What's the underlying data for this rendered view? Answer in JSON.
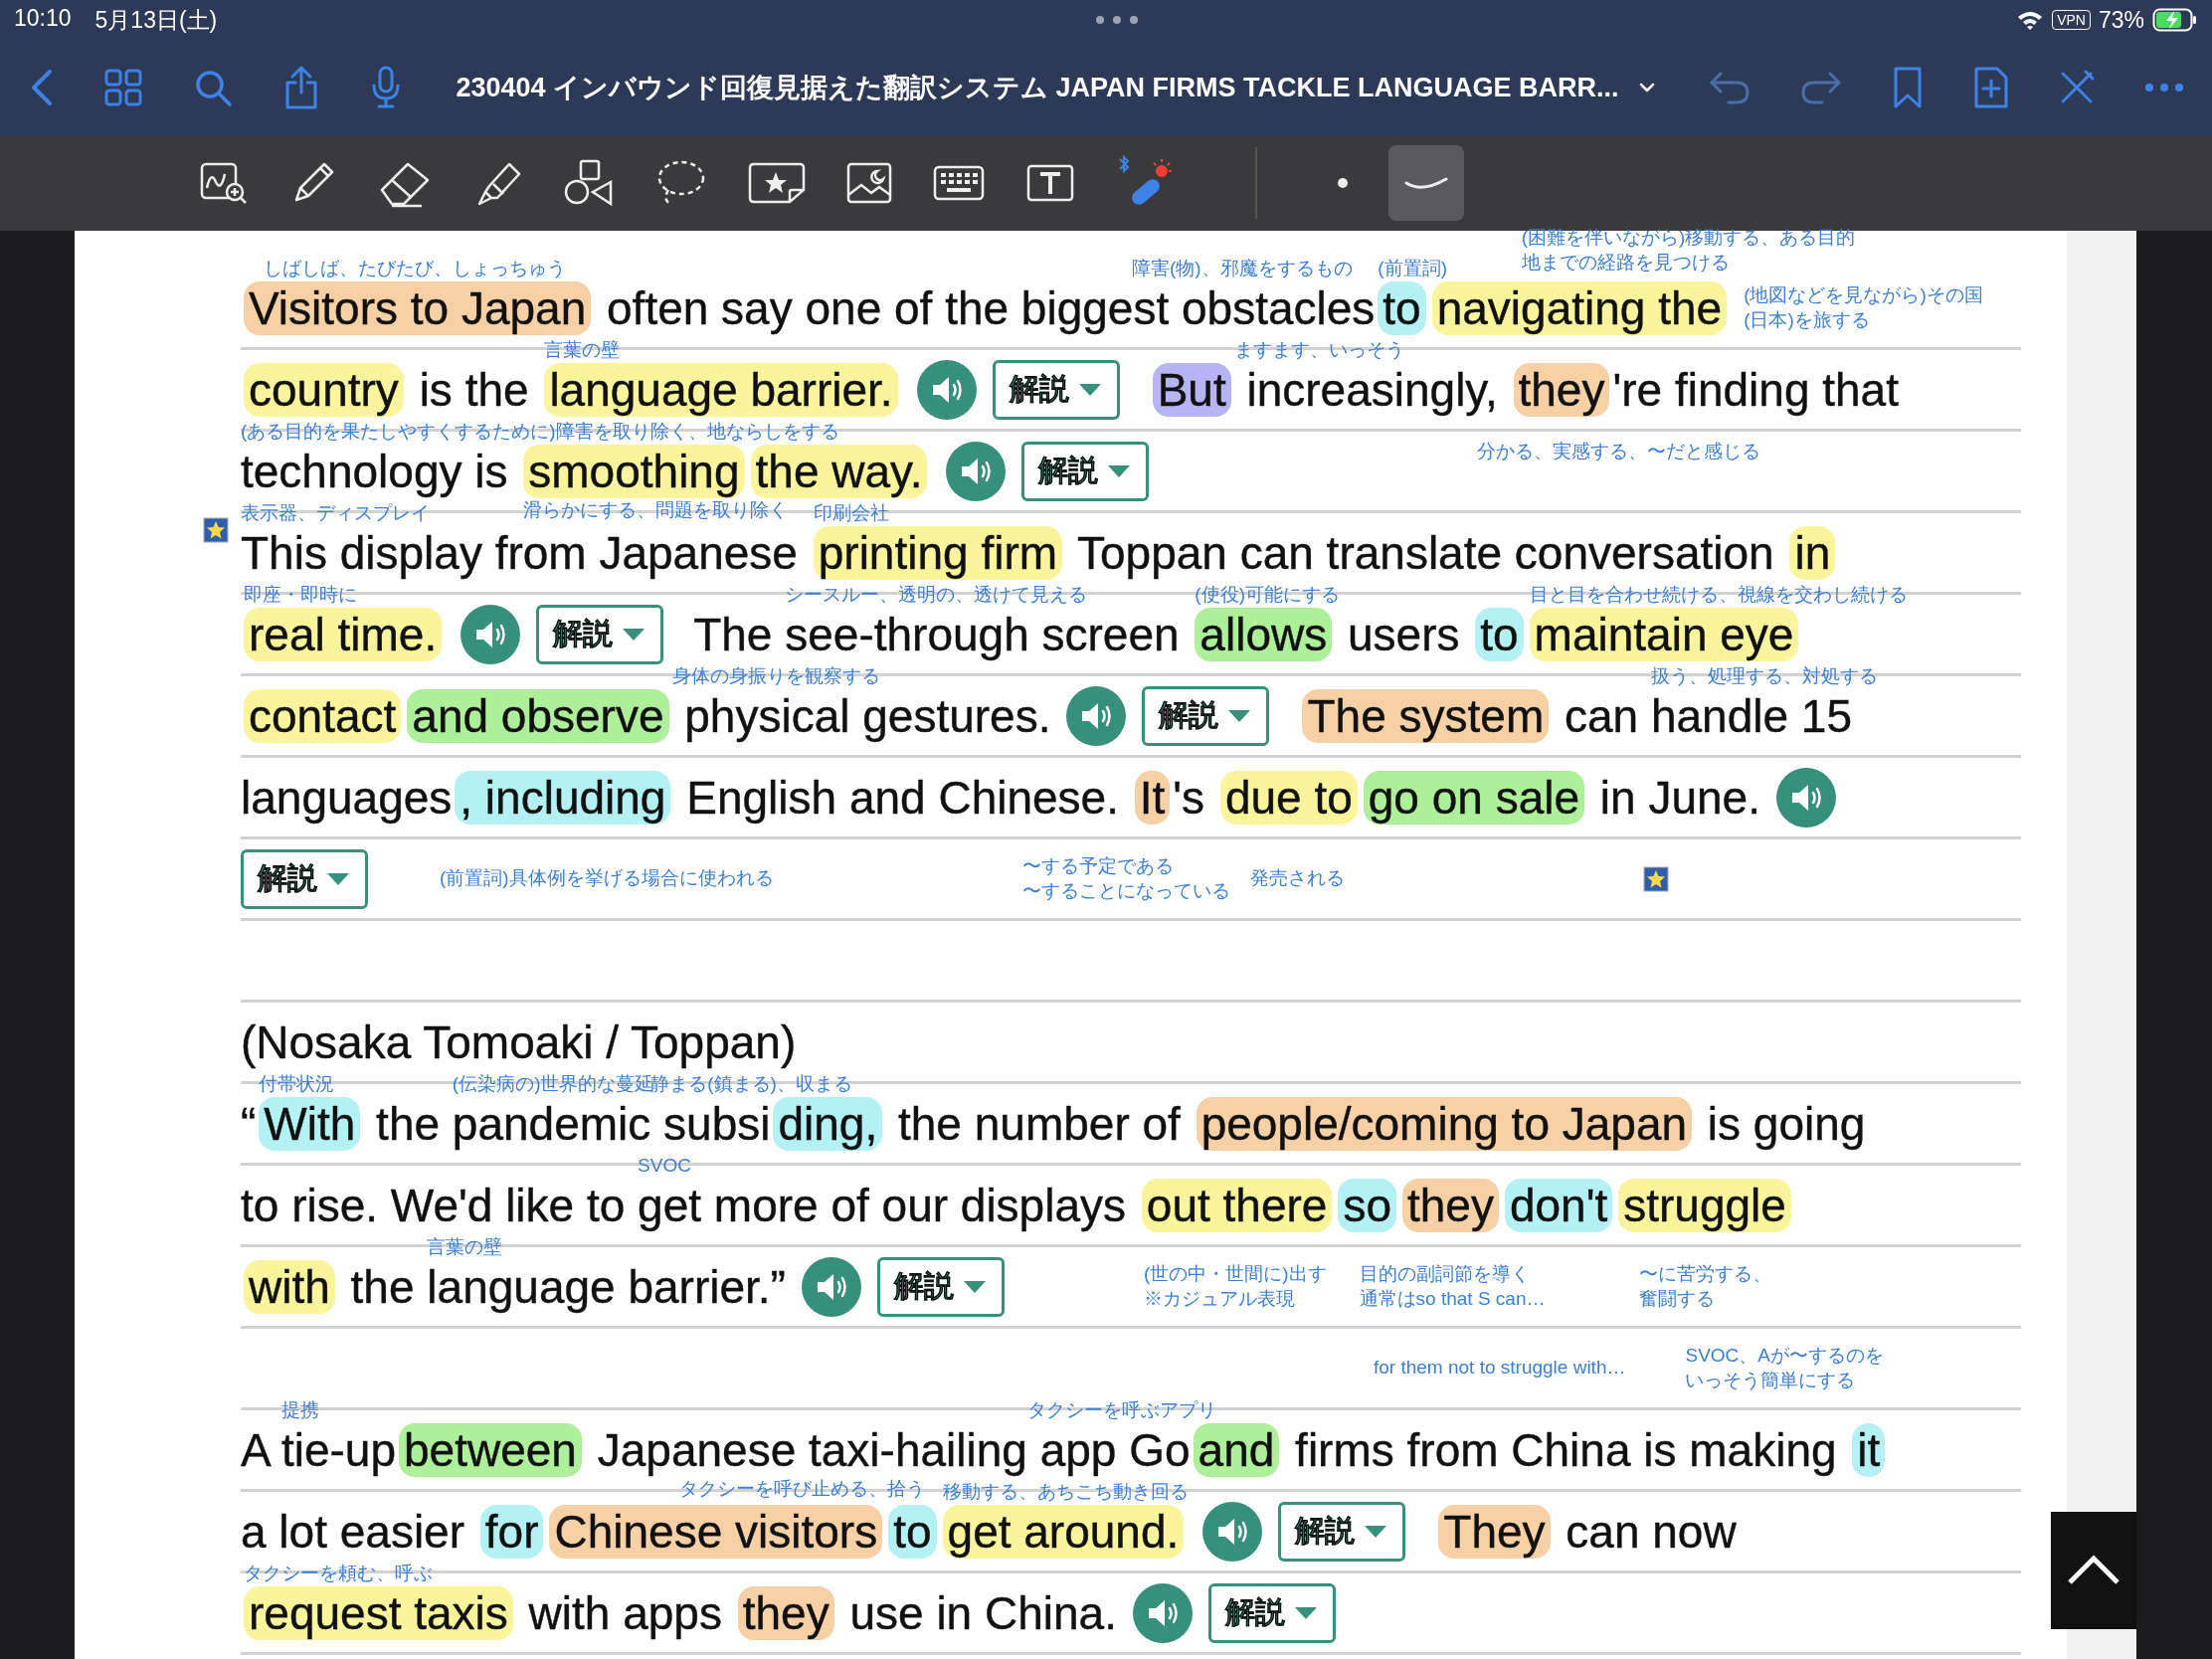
{
  "status_bar": {
    "time": "10:10",
    "date": "5月13日(土)",
    "vpn": "VPN",
    "battery": "73%"
  },
  "nav": {
    "title": "230404 インバウンド回復見据えた翻訳システム JAPAN FIRMS TACKLE LANGUAGE BARR..."
  },
  "toolbar": {
    "tools": [
      {
        "kind": "image-search",
        "selected": false
      },
      {
        "kind": "pencil",
        "selected": false
      },
      {
        "kind": "eraser",
        "selected": false
      },
      {
        "kind": "highlighter",
        "selected": false
      },
      {
        "kind": "shapes",
        "selected": false
      },
      {
        "kind": "lasso",
        "selected": false
      },
      {
        "kind": "sticker",
        "selected": false
      },
      {
        "kind": "image",
        "selected": false
      },
      {
        "kind": "keyboard",
        "selected": false
      },
      {
        "kind": "textbox",
        "selected": false
      },
      {
        "kind": "laser",
        "selected": false
      },
      {
        "kind": "dot",
        "selected": false
      },
      {
        "kind": "stroke",
        "selected": true
      }
    ]
  },
  "rows": [
    {
      "items": [
        {
          "kind": "text",
          "text": "Visitors to Japan",
          "color": "#f7d0a6",
          "note": "しばしば、たびたび、しょっちゅう"
        },
        {
          "kind": "text",
          "text": " often say one of the biggest "
        },
        {
          "kind": "text",
          "text": "obstacles",
          "note": "障害(物)、邪魔をするもの"
        },
        {
          "kind": "text",
          "text": "to",
          "color": "#b4f1f5",
          "note": "(前置詞)"
        },
        {
          "kind": "text",
          "text": "navigating the",
          "color": "#faf59c",
          "note": [
            "(困難を伴いながら)移動する、ある目的",
            "地までの経路を見つける"
          ]
        },
        {
          "kind": "note",
          "text": [
            "(地図などを見ながら)その国",
            "(日本)を旅する"
          ]
        }
      ]
    },
    {
      "items": [
        {
          "kind": "text",
          "text": "country",
          "color": "#faf59c"
        },
        {
          "kind": "text",
          "text": " is the "
        },
        {
          "kind": "text",
          "text": "language barrier.",
          "color": "#faf59c",
          "note": "言葉の壁"
        },
        {
          "kind": "speaker"
        },
        {
          "kind": "explain",
          "label": "解説"
        },
        {
          "kind": "text",
          "text": "But",
          "color": "#b6b4f3"
        },
        {
          "kind": "text",
          "text": " increasingly, ",
          "note": "ますます、いっそう"
        },
        {
          "kind": "text",
          "text": "they",
          "color": "#f7d0a6"
        },
        {
          "kind": "text",
          "text": "'re finding that"
        }
      ]
    },
    {
      "items": [
        {
          "kind": "text",
          "text": "technology is ",
          "note": "(ある目的を果たしやすくするために)障害を取り除く、地ならしをする"
        },
        {
          "kind": "text",
          "text": "smoothing",
          "color": "#faf59c",
          "subnote": "滑らかにする、問題を取り除く"
        },
        {
          "kind": "text",
          "text": "the way.",
          "color": "#faf59c"
        },
        {
          "kind": "speaker"
        },
        {
          "kind": "explain",
          "label": "解説"
        },
        {
          "kind": "note",
          "text": "分かる、実感する、〜だと感じる"
        }
      ]
    },
    {
      "items": [
        {
          "kind": "sticker"
        },
        {
          "kind": "text",
          "text": "This "
        },
        {
          "kind": "text",
          "text": "display",
          "note": "表示器、ディスプレイ"
        },
        {
          "kind": "text",
          "text": " from Japanese "
        },
        {
          "kind": "text",
          "text": "printing firm",
          "color": "#faf59c",
          "note": "印刷会社"
        },
        {
          "kind": "text",
          "text": " Toppan can translate conversation "
        },
        {
          "kind": "text",
          "text": "in",
          "color": "#faf59c"
        }
      ]
    },
    {
      "items": [
        {
          "kind": "text",
          "text": "real time.",
          "color": "#faf59c",
          "note": "即座・即時に"
        },
        {
          "kind": "speaker"
        },
        {
          "kind": "explain",
          "label": "解説"
        },
        {
          "kind": "text",
          "text": "The "
        },
        {
          "kind": "text",
          "text": "see-through",
          "note": "シースルー、透明の、透けて見える"
        },
        {
          "kind": "text",
          "text": " screen "
        },
        {
          "kind": "text",
          "text": "allows",
          "color": "#aef09a",
          "note": "(使役)可能にする"
        },
        {
          "kind": "text",
          "text": " users "
        },
        {
          "kind": "text",
          "text": "to",
          "color": "#b4f1f5"
        },
        {
          "kind": "text",
          "text": "maintain eye",
          "color": "#faf59c",
          "note": "目と目を合わせ続ける、視線を交わし続ける"
        }
      ]
    },
    {
      "items": [
        {
          "kind": "text",
          "text": "contact",
          "color": "#faf59c"
        },
        {
          "kind": "text",
          "text": "and observe",
          "color": "#aef09a"
        },
        {
          "kind": "text",
          "text": " physical gestures.",
          "note": "身体の身振りを観察する"
        },
        {
          "kind": "speaker"
        },
        {
          "kind": "explain",
          "label": "解説"
        },
        {
          "kind": "text",
          "text": "The system",
          "color": "#f7d0a6"
        },
        {
          "kind": "text",
          "text": " can "
        },
        {
          "kind": "text",
          "text": "handle 15",
          "note": "扱う、処理する、対処する"
        }
      ]
    },
    {
      "items": [
        {
          "kind": "text",
          "text": "languages"
        },
        {
          "kind": "text",
          "text": ", including",
          "color": "#b4f1f5"
        },
        {
          "kind": "text",
          "text": " English and Chinese. "
        },
        {
          "kind": "text",
          "text": "It",
          "color": "#f7d0a6"
        },
        {
          "kind": "text",
          "text": "'s "
        },
        {
          "kind": "text",
          "text": "due to",
          "color": "#faf59c"
        },
        {
          "kind": "text",
          "text": "go on sale",
          "color": "#aef09a"
        },
        {
          "kind": "text",
          "text": " in June."
        },
        {
          "kind": "speaker"
        }
      ]
    },
    {
      "items": [
        {
          "kind": "explain",
          "label": "解説"
        },
        {
          "kind": "note",
          "text": "(前置詞)具体例を挙げる場合に使われる"
        },
        {
          "kind": "note",
          "text": [
            "〜する予定である",
            "〜することになっている"
          ]
        },
        {
          "kind": "note",
          "text": "発売される"
        },
        {
          "kind": "sticker"
        }
      ]
    },
    {
      "items": []
    },
    {
      "items": [
        {
          "kind": "text",
          "text": "(Nosaka Tomoaki / Toppan)"
        }
      ]
    },
    {
      "items": [
        {
          "kind": "text",
          "text": "“"
        },
        {
          "kind": "text",
          "text": "With",
          "color": "#b4f1f5",
          "note": "付帯状況"
        },
        {
          "kind": "text",
          "text": " the "
        },
        {
          "kind": "text",
          "text": "pandemic",
          "note": "(伝染病の)世界的な蔓延"
        },
        {
          "kind": "text",
          "text": " subsi",
          "note": "静まる(鎮まる)、収まる"
        },
        {
          "kind": "text",
          "text": "ding,",
          "color": "#b4f1f5"
        },
        {
          "kind": "text",
          "text": " the number of "
        },
        {
          "kind": "text",
          "text": "people/coming to Japan",
          "color": "#f7d0a6"
        },
        {
          "kind": "text",
          "text": " is going"
        }
      ]
    },
    {
      "items": [
        {
          "kind": "text",
          "text": "to rise. We'd like to "
        },
        {
          "kind": "text",
          "text": "get",
          "note": "SVOC"
        },
        {
          "kind": "text",
          "text": " more of our displays "
        },
        {
          "kind": "text",
          "text": "out there",
          "color": "#faf59c"
        },
        {
          "kind": "text",
          "text": "so",
          "color": "#b4f1f5"
        },
        {
          "kind": "text",
          "text": "they",
          "color": "#f7d0a6"
        },
        {
          "kind": "text",
          "text": "don't",
          "color": "#b4f1f5"
        },
        {
          "kind": "text",
          "text": "struggle",
          "color": "#faf59c"
        }
      ]
    },
    {
      "items": [
        {
          "kind": "text",
          "text": "with",
          "color": "#faf59c"
        },
        {
          "kind": "text",
          "text": " the "
        },
        {
          "kind": "text",
          "text": "language barrier.”",
          "note": "言葉の壁"
        },
        {
          "kind": "speaker"
        },
        {
          "kind": "explain",
          "label": "解説"
        },
        {
          "kind": "note",
          "text": [
            "(世の中・世間に)出す",
            "※カジュアル表現"
          ]
        },
        {
          "kind": "note",
          "text": [
            "目的の副詞節を導く",
            "通常はso that S can…"
          ]
        },
        {
          "kind": "note",
          "text": [
            "〜に苦労する、",
            "奮闘する"
          ]
        }
      ]
    },
    {
      "items": [
        {
          "kind": "note",
          "text": "for them not to struggle with…"
        },
        {
          "kind": "note",
          "text": [
            "SVOC、Aが〜するのを",
            "いっそう簡単にする"
          ]
        }
      ]
    },
    {
      "items": [
        {
          "kind": "text",
          "text": "A "
        },
        {
          "kind": "text",
          "text": "tie-up",
          "note": "提携"
        },
        {
          "kind": "text",
          "text": "between",
          "color": "#aef09a"
        },
        {
          "kind": "text",
          "text": " Japanese "
        },
        {
          "kind": "text",
          "text": "taxi-hailing",
          "subnote": "タクシーを呼び止める、拾う"
        },
        {
          "kind": "text",
          "text": " app Go",
          "note": "タクシーを呼ぶアプリ"
        },
        {
          "kind": "text",
          "text": "and",
          "color": "#aef09a"
        },
        {
          "kind": "text",
          "text": " firms from China is making "
        },
        {
          "kind": "text",
          "text": "it",
          "color": "#b4f1f5"
        }
      ]
    },
    {
      "items": [
        {
          "kind": "text",
          "text": "a lot easier "
        },
        {
          "kind": "text",
          "text": "for",
          "color": "#b4f1f5"
        },
        {
          "kind": "text",
          "text": "Chinese visitors",
          "color": "#f7d0a6"
        },
        {
          "kind": "text",
          "text": "to",
          "color": "#b4f1f5"
        },
        {
          "kind": "text",
          "text": "get around.",
          "color": "#faf59c",
          "note": "移動する、あちこち動き回る"
        },
        {
          "kind": "speaker"
        },
        {
          "kind": "explain",
          "label": "解説"
        },
        {
          "kind": "text",
          "text": "They",
          "color": "#f7d0a6"
        },
        {
          "kind": "text",
          "text": " can now"
        }
      ]
    },
    {
      "items": [
        {
          "kind": "text",
          "text": "request taxis",
          "color": "#faf59c",
          "note": "タクシーを頼む、呼ぶ"
        },
        {
          "kind": "text",
          "text": " with apps "
        },
        {
          "kind": "text",
          "text": "they",
          "color": "#f7d0a6"
        },
        {
          "kind": "text",
          "text": " use in China."
        },
        {
          "kind": "speaker"
        },
        {
          "kind": "explain",
          "label": "解説"
        }
      ]
    }
  ]
}
